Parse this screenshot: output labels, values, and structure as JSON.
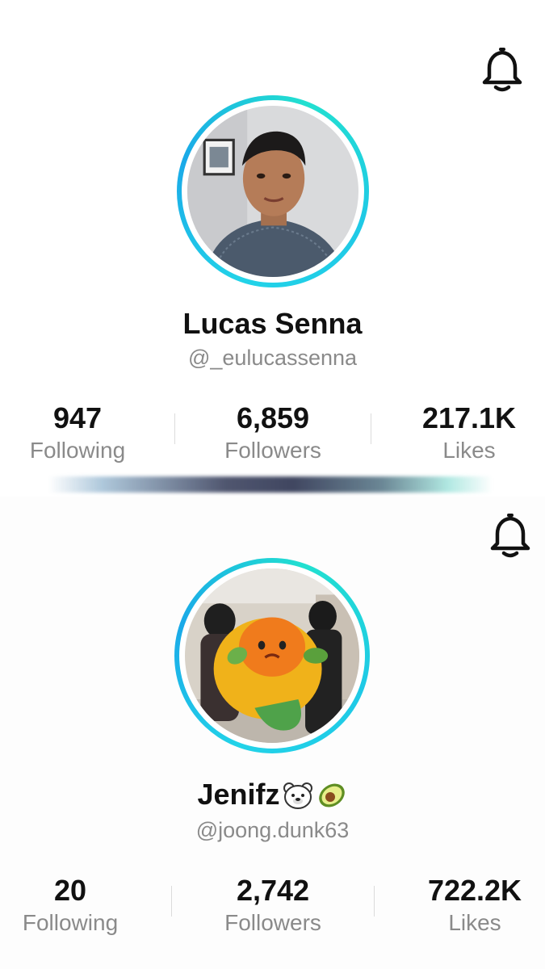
{
  "profiles": [
    {
      "name": "Lucas Senna",
      "handle": "@_eulucassenna",
      "stats": [
        {
          "value": "947",
          "label": "Following"
        },
        {
          "value": "6,859",
          "label": "Followers"
        },
        {
          "value": "217.1K",
          "label": "Likes"
        }
      ],
      "icons": {
        "bell": "bell-icon"
      }
    },
    {
      "name": "Jenifz",
      "name_emojis": [
        "polar-bear-emoji",
        "avocado-emoji"
      ],
      "handle": "@joong.dunk63",
      "stats": [
        {
          "value": "20",
          "label": "Following"
        },
        {
          "value": "2,742",
          "label": "Followers"
        },
        {
          "value": "722.2K",
          "label": "Likes"
        }
      ],
      "icons": {
        "bell": "bell-icon"
      }
    }
  ],
  "colors": {
    "avatar_ring": "#22d3e8",
    "text_primary": "#111111",
    "text_secondary": "#8a8a8a"
  }
}
